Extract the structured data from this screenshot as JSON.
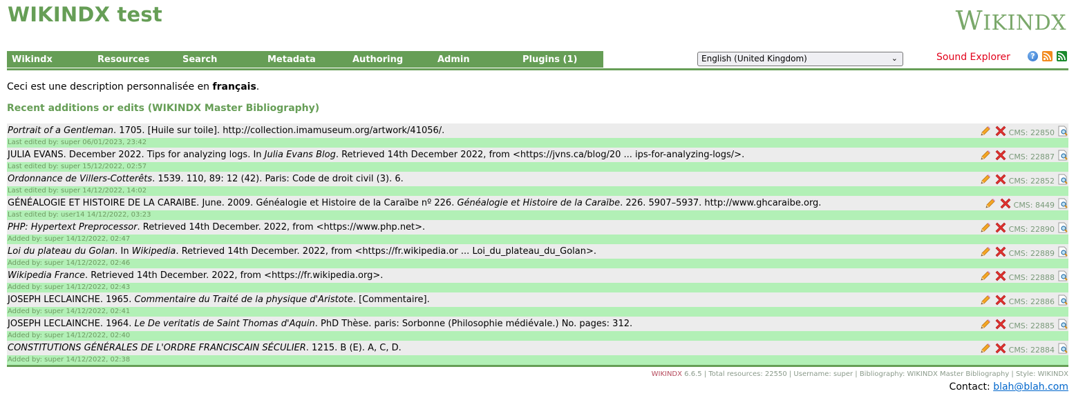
{
  "header": {
    "site_title": "WIKINDX test",
    "logo_text_first": "W",
    "logo_text_rest": "IKINDX"
  },
  "nav": {
    "items": [
      {
        "label": "Wikindx"
      },
      {
        "label": "Resources"
      },
      {
        "label": "Search"
      },
      {
        "label": "Metadata"
      },
      {
        "label": "Authoring"
      },
      {
        "label": "Admin"
      },
      {
        "label": "Plugins (1)"
      }
    ]
  },
  "language_select": {
    "selected": "English (United Kingdom)"
  },
  "sound_explorer": "Sound Explorer",
  "icons": {
    "help": "help-icon",
    "rss": "rss-icon",
    "rss_alt": "rss-alt-icon"
  },
  "description": {
    "prefix": "Ceci est une description personnalisée en ",
    "bold": "français",
    "suffix": "."
  },
  "section_heading": "Recent additions or edits (WIKINDX Master Bibliography)",
  "resources": [
    {
      "parts": [
        {
          "text": "Portrait of a Gentleman",
          "italic": true
        },
        {
          "text": ". 1705. [Huile sur toile]. http://collection.imamuseum.org/artwork/41056/.",
          "italic": false
        }
      ],
      "meta": "Last edited by: super 06/01/2023, 23:42",
      "cms": "CMS: 22850"
    },
    {
      "parts": [
        {
          "text": "JULIA EVANS. December 2022. Tips for analyzing logs. In ",
          "italic": false
        },
        {
          "text": "Julia Evans Blog",
          "italic": true
        },
        {
          "text": ". Retrieved 14th December 2022, from <https://jvns.ca/blog/20 ... ips-for-analyzing-logs/>.",
          "italic": false
        }
      ],
      "meta": "Last edited by: super 15/12/2022, 02:57",
      "cms": "CMS: 22887"
    },
    {
      "parts": [
        {
          "text": "Ordonnance de Villers-Cotterêts",
          "italic": true
        },
        {
          "text": ". 1539. 110, 89: 12 (42). Paris: Code de droit civil (3). 6.",
          "italic": false
        }
      ],
      "meta": "Last edited by: super 14/12/2022, 14:02",
      "cms": "CMS: 22852"
    },
    {
      "parts": [
        {
          "text": "GÉNÉALOGIE ET HISTOIRE DE LA CARAIBE. June. 2009. Généalogie et Histoire de la Caraïbe nº 226. ",
          "italic": false
        },
        {
          "text": "Généalogie et Histoire de la Caraïbe",
          "italic": true
        },
        {
          "text": ". 226. 5907–5937. http://www.ghcaraibe.org.",
          "italic": false
        }
      ],
      "meta": "Last edited by: user14 14/12/2022, 03:23",
      "cms": "CMS: 8449"
    },
    {
      "parts": [
        {
          "text": "PHP: Hypertext Preprocessor",
          "italic": true
        },
        {
          "text": ". Retrieved 14th December. 2022, from <https://www.php.net>.",
          "italic": false
        }
      ],
      "meta": "Added by: super 14/12/2022, 02:47",
      "cms": "CMS: 22890"
    },
    {
      "parts": [
        {
          "text": "Loi du plateau du Golan",
          "italic": true
        },
        {
          "text": ". In ",
          "italic": false
        },
        {
          "text": "Wikipedia",
          "italic": true
        },
        {
          "text": ". Retrieved 14th December. 2022, from <https://fr.wikipedia.or ... Loi_du_plateau_du_Golan>.",
          "italic": false
        }
      ],
      "meta": "Added by: super 14/12/2022, 02:46",
      "cms": "CMS: 22889"
    },
    {
      "parts": [
        {
          "text": "Wikipedia France",
          "italic": true
        },
        {
          "text": ". Retrieved 14th December. 2022, from <https://fr.wikipedia.org>.",
          "italic": false
        }
      ],
      "meta": "Added by: super 14/12/2022, 02:43",
      "cms": "CMS: 22888"
    },
    {
      "parts": [
        {
          "text": "JOSEPH LECLAINCHE. 1965. ",
          "italic": false
        },
        {
          "text": "Commentaire du Traité de la physique d'Aristote",
          "italic": true
        },
        {
          "text": ". [Commentaire].",
          "italic": false
        }
      ],
      "meta": "Added by: super 14/12/2022, 02:41",
      "cms": "CMS: 22886"
    },
    {
      "parts": [
        {
          "text": "JOSEPH LECLAINCHE. 1964. ",
          "italic": false
        },
        {
          "text": "Le De veritatis de Saint Thomas d'Aquin",
          "italic": true
        },
        {
          "text": ". PhD Thèse. paris: Sorbonne (Philosophie médiévale.) No. pages: 312.",
          "italic": false
        }
      ],
      "meta": "Added by: super 14/12/2022, 02:40",
      "cms": "CMS: 22885"
    },
    {
      "parts": [
        {
          "text": "CONSTITUTIONS GÉNÉRALES DE L'ORDRE FRANCISCAIN SÉCULIER",
          "italic": true
        },
        {
          "text": ". 1215. B (E). A, C, D.",
          "italic": false
        }
      ],
      "meta": "Added by: super 14/12/2022, 02:38",
      "cms": "CMS: 22884"
    }
  ],
  "footer": {
    "brand": "WIKINDX",
    "info": " 6.6.5 | Total resources: 22550 | Username: super | Bibliography: WIKINDX Master Bibliography | Style: WIKINDX",
    "contact_label": "Contact: ",
    "contact_email": "blah@blah.com"
  },
  "colors": {
    "brand_green": "#669e56",
    "meta_row_bg": "#b2f0b6",
    "main_row_bg": "#ececec",
    "sound_explorer": "#e2001a",
    "link": "#0066cc"
  }
}
